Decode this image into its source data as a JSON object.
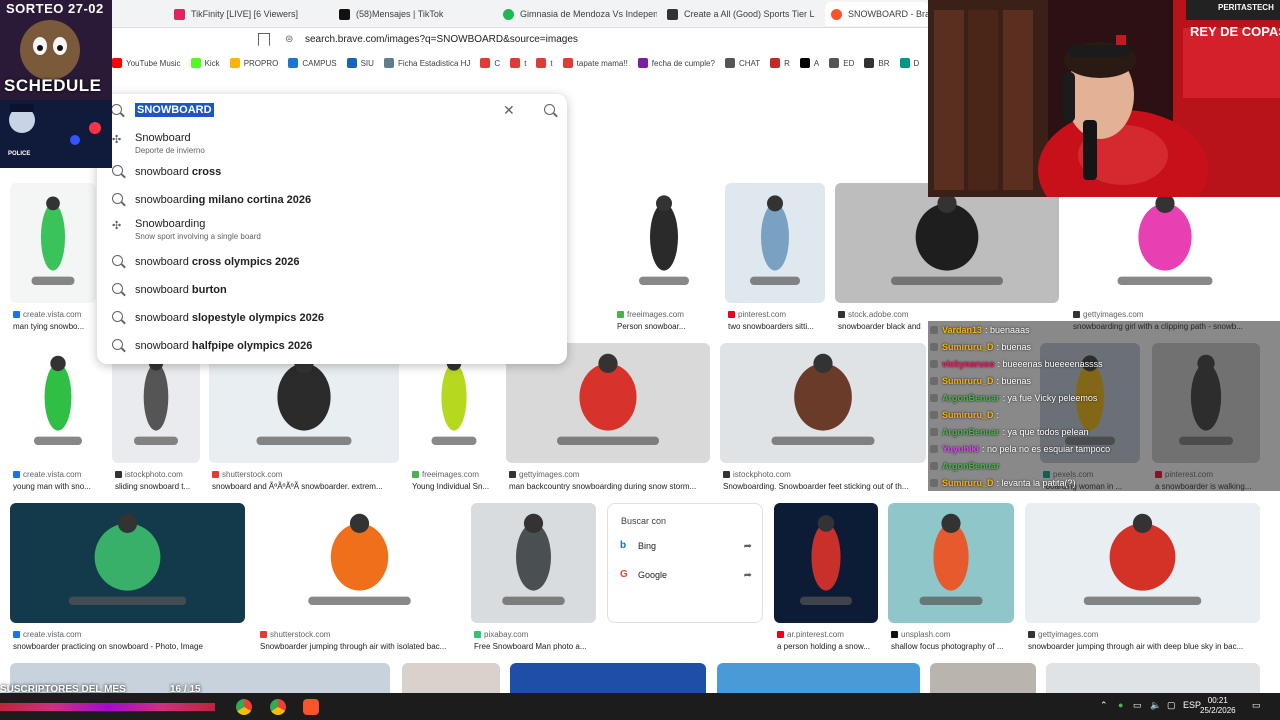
{
  "tabs": [
    {
      "label": "TikFinity [LIVE] [6 Viewers]",
      "color": "#e0245e"
    },
    {
      "label": "(58)Mensajes | TikTok",
      "color": "#111111"
    },
    {
      "label": "Gimnasia de Mendoza Vs Independie",
      "color": "#1db954"
    },
    {
      "label": "Create a All (Good) Sports Tier L",
      "color": "#333333"
    },
    {
      "label": "SNOWBOARD - Brave S",
      "color": "#fb542b"
    }
  ],
  "address": {
    "url": "search.brave.com/images?q=SNOWBOARD&source=images"
  },
  "bookmarks": [
    {
      "label": "YouTube Music",
      "color": "#ff0000"
    },
    {
      "label": "Kick",
      "color": "#53fc18"
    },
    {
      "label": "PROPRO",
      "color": "#ffb400"
    },
    {
      "label": "CAMPUS",
      "color": "#1976d2"
    },
    {
      "label": "SIU",
      "color": "#1565c0"
    },
    {
      "label": "Ficha Estadistica HJ",
      "color": "#607d8b"
    },
    {
      "label": "C",
      "color": "#e53935"
    },
    {
      "label": "t",
      "color": "#e53935"
    },
    {
      "label": "t",
      "color": "#e53935"
    },
    {
      "label": "tapate mama!!",
      "color": "#e53935"
    },
    {
      "label": "fecha de cumple?",
      "color": "#7b1fa2"
    },
    {
      "label": "CHAT",
      "color": "#555555"
    },
    {
      "label": "R",
      "color": "#c62828"
    },
    {
      "label": "A",
      "color": "#000000"
    },
    {
      "label": "ED",
      "color": "#555555"
    },
    {
      "label": "BR",
      "color": "#333333"
    },
    {
      "label": "D",
      "color": "#009688"
    }
  ],
  "search": {
    "query": "SNOWBOARD",
    "suggestions": [
      {
        "plain": "Snowboard",
        "bold": "",
        "sub": "Deporte de invierno",
        "kind": "entity"
      },
      {
        "plain": "snowboard ",
        "bold": "cross",
        "sub": "",
        "kind": "query"
      },
      {
        "plain": "snowboard",
        "bold": "ing milano cortina 2026",
        "sub": "",
        "kind": "query"
      },
      {
        "plain": "Snowboarding",
        "bold": "",
        "sub": "Snow sport involving a single board",
        "kind": "entity"
      },
      {
        "plain": "snowboard ",
        "bold": "cross olympics 2026",
        "sub": "",
        "kind": "query"
      },
      {
        "plain": "snowboard ",
        "bold": "burton",
        "sub": "",
        "kind": "query"
      },
      {
        "plain": "snowboard ",
        "bold": "slopestyle olympics 2026",
        "sub": "",
        "kind": "query"
      },
      {
        "plain": "snowboard ",
        "bold": "halfpipe olympics 2026",
        "sub": "",
        "kind": "query"
      }
    ]
  },
  "results": [
    {
      "source": "create.vista.com",
      "caption": "man tying snowbo...",
      "srcColor": "#1a73e8"
    },
    {
      "source": "freeimages.com",
      "caption": "Person snowboar...",
      "srcColor": "#4caf50"
    },
    {
      "source": "pinterest.com",
      "caption": "two snowboarders sitti...",
      "srcColor": "#e60023"
    },
    {
      "source": "stock.adobe.com",
      "caption": "snowboarder black and",
      "srcColor": "#333333"
    },
    {
      "source": "gettyimages.com",
      "caption": "snowboarding girl with a clipping path - snowb...",
      "srcColor": "#333333"
    },
    {
      "source": "create.vista.com",
      "caption": "young man with sno...",
      "srcColor": "#1a73e8"
    },
    {
      "source": "istockphoto.com",
      "caption": "sliding snowboard t...",
      "srcColor": "#333333"
    },
    {
      "source": "shutterstock.com",
      "caption": "snowboard and ÃºÃºÃºÃ snowboarder. extrem...",
      "srcColor": "#e53935"
    },
    {
      "source": "freeimages.com",
      "caption": "Young Individual Sn...",
      "srcColor": "#4caf50"
    },
    {
      "source": "gettyimages.com",
      "caption": "man backcountry snowboarding during snow storm...",
      "srcColor": "#333333"
    },
    {
      "source": "istockphoto.com",
      "caption": "Snowboarding. Snowboarder feet sticking out of th...",
      "srcColor": "#333333"
    },
    {
      "source": "pexels.com",
      "caption": "-boarding woman in ...",
      "srcColor": "#05a081"
    },
    {
      "source": "pinterest.com",
      "caption": "a snowboarder is walking...",
      "srcColor": "#e60023"
    },
    {
      "source": "create.vista.com",
      "caption": "snowboarder practicing on snowboard - Photo, Image",
      "srcColor": "#1a73e8"
    },
    {
      "source": "shutterstock.com",
      "caption": "Snowboarder jumping through air with isolated bac...",
      "srcColor": "#e53935"
    },
    {
      "source": "pixabay.com",
      "caption": "Free Snowboard Man photo a...",
      "srcColor": "#2ec66d"
    },
    {
      "source": "ar.pinterest.com",
      "caption": "a person holding a snow...",
      "srcColor": "#e60023"
    },
    {
      "source": "unsplash.com",
      "caption": "shallow focus photography of ...",
      "srcColor": "#111111"
    },
    {
      "source": "gettyimages.com",
      "caption": "snowboarder jumping through air with deep blue sky in bac...",
      "srcColor": "#333333"
    }
  ],
  "search_with": {
    "title": "Buscar con",
    "options": [
      {
        "label": "Bing",
        "color": "#0078d4"
      },
      {
        "label": "Google",
        "color": "#ea4335"
      }
    ]
  },
  "overlay": {
    "sorteo": "SORTEO 27-02",
    "schedule": "SCHEDULE",
    "police": "POLICE",
    "subs": "SUSCRIPTORES DEL MES",
    "subs_count": "16 / 15"
  },
  "webcam": {
    "banner": "REY DE COPAS",
    "brand": "PERITASTECH"
  },
  "chat": [
    {
      "user": "Vardan13",
      "msg": ": buenaaas",
      "color": "#f4b400"
    },
    {
      "user": "Sumiruru_D",
      "msg": ": buenas",
      "color": "#f4b400"
    },
    {
      "user": "vickynaruso",
      "msg": ": bueeenas bueeeenassss",
      "color": "#e91e63"
    },
    {
      "user": "Sumiruru_D",
      "msg": ": buenas",
      "color": "#f4b400"
    },
    {
      "user": "ArgonBenuar",
      "msg": ": ya fue Vicky peleemos",
      "color": "#4caf50"
    },
    {
      "user": "Sumiruru_D",
      "msg": ":",
      "color": "#f4b400"
    },
    {
      "user": "ArgonBenuar",
      "msg": ": ya que todos pelean",
      "color": "#4caf50"
    },
    {
      "user": "Yuyuhiki",
      "msg": ": no pela no es esquiar tampoco",
      "color": "#e040fb"
    },
    {
      "user": "ArgonBenuar",
      "msg": "",
      "color": "#4caf50"
    },
    {
      "user": "Sumiruru_D",
      "msg": ": levanta la patita(?)",
      "color": "#f4b400"
    }
  ],
  "taskbar": {
    "lang": "ESP",
    "time": "00:21",
    "date": "25/2/2026"
  }
}
